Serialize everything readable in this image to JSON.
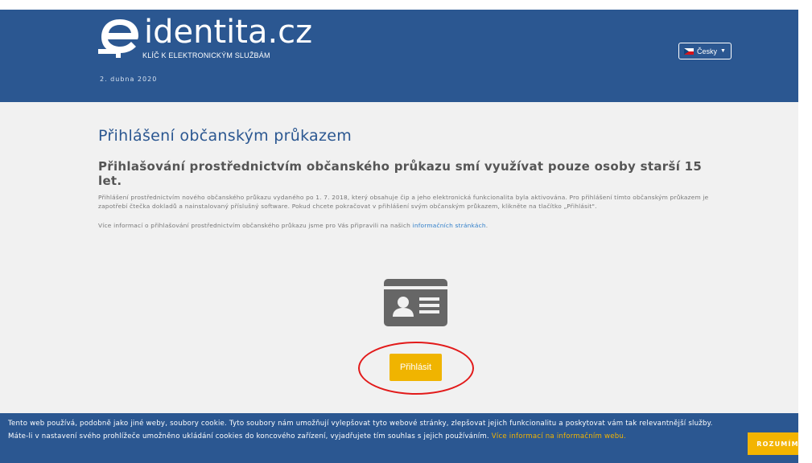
{
  "header": {
    "logo_text": "identita.cz",
    "logo_sub": "KLÍČ K ELEKTRONICKÝM SLUŽBÁM",
    "date": "2. dubna 2020",
    "language_label": "Česky",
    "brand_color": "#2b5791"
  },
  "main": {
    "title": "Přihlášení občanským průkazem",
    "subtitle": "Přihlašování prostřednictvím občanského průkazu smí využívat pouze osoby starší 15 let.",
    "paragraph": "Přihlášení prostřednictvím nového občanského průkazu vydaného po 1. 7. 2018, který obsahuje čip a jeho elektronická funkcionalita byla aktivována. Pro přihlášení tímto občanským průkazem je zapotřebí čtečka dokladů a nainstalovaný příslušný software. Pokud chcete pokračovat v přihlášení svým občanským průkazem, klikněte na tlačítko „Přihlásit\".",
    "info_text": "Více informací o přihlašování prostřednictvím občanského průkazu jsme pro Vás připravili na našich ",
    "info_link": "informačních stránkách",
    "info_end": ".",
    "id_card_icon": "id-card-icon",
    "login_label": "Přihlásit",
    "accent_color": "#f0b400",
    "highlight_color": "#e21a1a"
  },
  "cookie": {
    "text": "Tento web používá, podobně jako jiné weby, soubory cookie. Tyto soubory nám umožňují vylepšovat tyto webové stránky, zlepšovat jejich funkcionalitu a poskytovat vám tak relevantnější služby. Máte-li v nastavení svého prohlížeče umožněno ukládání cookies do koncového zařízení, vyjadřujete tím souhlas s jejich používáním. ",
    "link": "Více informací na informačním webu.",
    "agree_label": "ROZUMÍM"
  }
}
